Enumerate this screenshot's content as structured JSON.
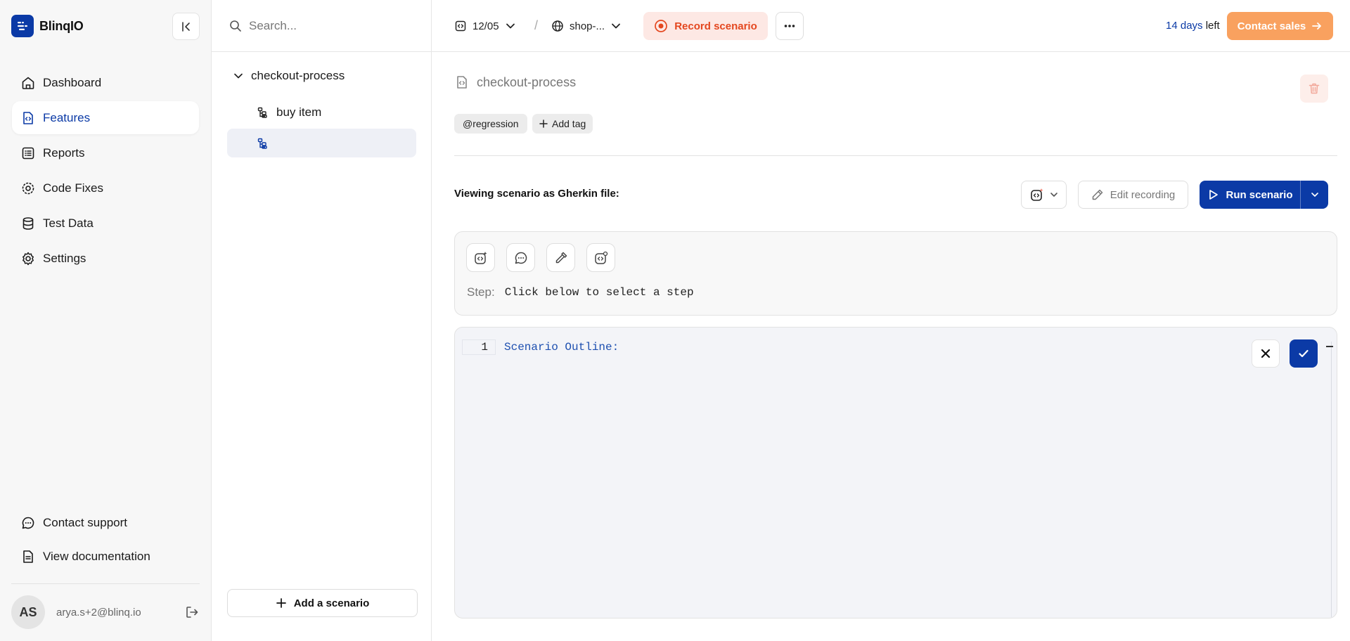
{
  "brand": {
    "name": "BlinqIO",
    "accent": "#0b3aa6"
  },
  "sidebar": {
    "items": [
      {
        "label": "Dashboard",
        "icon": "home-icon",
        "active": false
      },
      {
        "label": "Features",
        "icon": "feature-file-icon",
        "active": true
      },
      {
        "label": "Reports",
        "icon": "report-list-icon",
        "active": false
      },
      {
        "label": "Code Fixes",
        "icon": "code-fix-icon",
        "active": false
      },
      {
        "label": "Test Data",
        "icon": "database-icon",
        "active": false
      },
      {
        "label": "Settings",
        "icon": "gear-icon",
        "active": false
      }
    ],
    "bottom_links": [
      {
        "label": "Contact support",
        "icon": "chat-icon"
      },
      {
        "label": "View documentation",
        "icon": "document-icon"
      }
    ],
    "user": {
      "initials": "AS",
      "email": "arya.s+2@blinq.io"
    }
  },
  "list_panel": {
    "search_placeholder": "Search...",
    "feature_name": "checkout-process",
    "scenarios": [
      {
        "label": "buy item",
        "selected": false
      },
      {
        "label": "",
        "selected": true
      }
    ],
    "add_scenario_label": "Add a scenario"
  },
  "topbar": {
    "version": "12/05",
    "environment": "shop-...",
    "record_label": "Record scenario",
    "trial_days": "14 days",
    "trial_suffix": " left",
    "contact_sales_label": "Contact sales",
    "record_color": "#e4471f",
    "sales_color": "#f9a15f"
  },
  "main": {
    "feature_title": "checkout-process",
    "tags": [
      "@regression"
    ],
    "add_tag_label": "Add tag",
    "viewing_label": "Viewing scenario as Gherkin file:",
    "edit_recording_label": "Edit recording",
    "run_scenario_label": "Run scenario",
    "step_label": "Step:",
    "step_value": "Click below to select a step",
    "editor": {
      "line_number": "1",
      "code": "Scenario Outline:"
    }
  }
}
